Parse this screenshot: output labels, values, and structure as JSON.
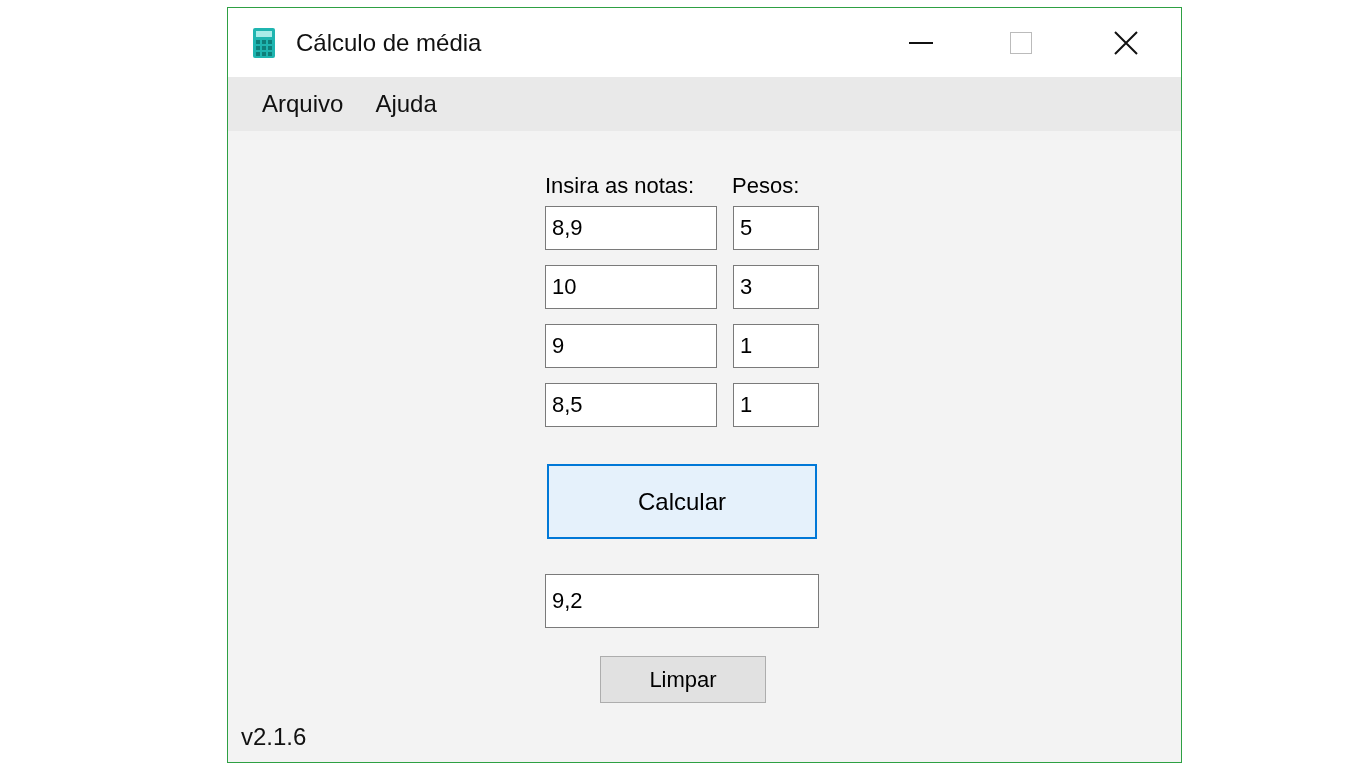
{
  "window": {
    "title": "Cálculo de média"
  },
  "menu": [
    "Arquivo",
    "Ajuda"
  ],
  "labels": {
    "notes": "Insira as notas:",
    "weights": "Pesos:"
  },
  "rows": [
    {
      "note": "8,9",
      "weight": "5"
    },
    {
      "note": "10",
      "weight": "3"
    },
    {
      "note": "9",
      "weight": "1"
    },
    {
      "note": "8,5",
      "weight": "1"
    }
  ],
  "calculate_button": "Calcular",
  "result": "9,2",
  "clear_button": "Limpar",
  "version": "v2.1.6"
}
